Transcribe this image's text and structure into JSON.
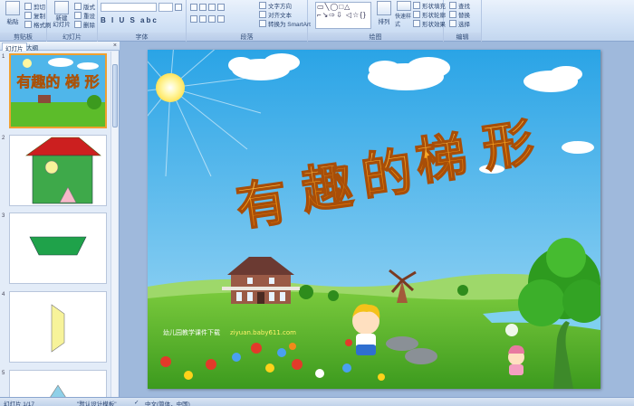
{
  "ribbon": {
    "groups": [
      {
        "label": "剪贴板"
      },
      {
        "label": "幻灯片"
      },
      {
        "label": "字体"
      },
      {
        "label": "段落"
      },
      {
        "label": "绘图"
      },
      {
        "label": "编辑"
      }
    ],
    "clipboard": {
      "paste": "粘贴",
      "cut": "剪切",
      "copy": "复制",
      "format_painter": "格式刷"
    },
    "slides": {
      "new_slide": "新建\n幻灯片",
      "layout": "版式",
      "reset": "重设",
      "delete": "删除"
    },
    "paragraph": {
      "text_direction": "文字方向",
      "align_text": "对齐文本",
      "smartart": "转换为 SmartArt"
    },
    "drawing": {
      "arrange": "排列",
      "quick_styles": "快速样式",
      "shape_fill": "形状填充",
      "shape_outline": "形状轮廓",
      "shape_effects": "形状效果"
    },
    "editing": {
      "find": "查找",
      "replace": "替换",
      "select": "选择"
    }
  },
  "panel": {
    "tabs": [
      "幻灯片",
      "大纲"
    ],
    "close": "×",
    "slide_numbers": [
      "1",
      "2",
      "3",
      "4",
      "5"
    ]
  },
  "slide": {
    "title_chars": [
      "有",
      "趣",
      "的",
      "梯",
      "形"
    ],
    "thumb_title": "有趣的 梯 形",
    "website_label": "幼儿园教学课件下载",
    "website_url": "ziyuan.baby611.com"
  },
  "status": {
    "slide_count": "幻灯片 1/17",
    "theme": "\"默认设计模板\"",
    "language": "中文(简体，中国)"
  },
  "colors": {
    "sky": "#4fb6ea",
    "grass": "#5cbc2a",
    "title_orange": "#f08a10",
    "house_roof": "#cc1f1f",
    "trapezoid_green": "#1fa24a",
    "trapezoid_yellow": "#f7f39a",
    "triangle_pink": "#f7b8c8",
    "thumb_selected": "#f0a030"
  }
}
